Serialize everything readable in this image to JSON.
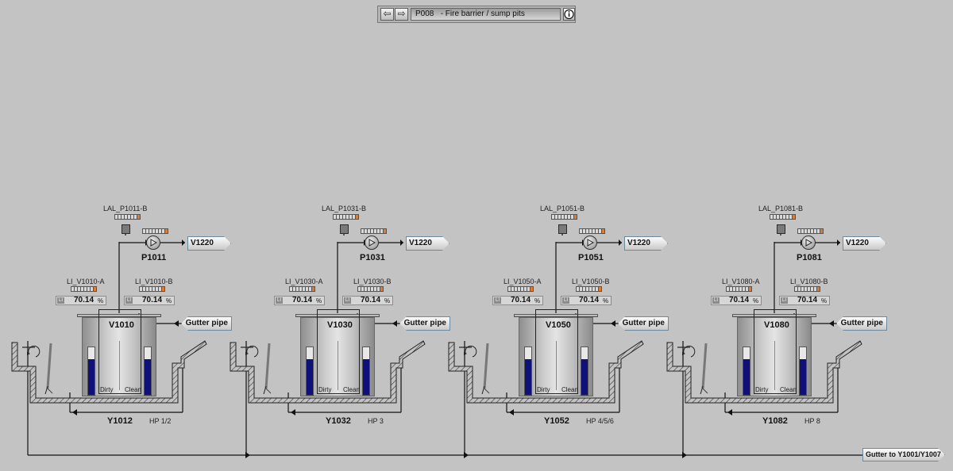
{
  "nav": {
    "back_icon": "arrow-left-icon",
    "forward_icon": "arrow-right-icon",
    "title": "P008   - Fire barrier / sump pits",
    "info_icon": "info-icon"
  },
  "common": {
    "pct_unit": "%",
    "dirty_label": "Dirty",
    "clean_label": "Clean",
    "li_tag": "LI",
    "colors": {
      "led_on": "#e57a2e",
      "level_fill": "#10107a",
      "background": "#c3c3c3"
    }
  },
  "stations": [
    {
      "lal": "LAL_P1011-B",
      "pump": "P1011",
      "dest": "V1220",
      "li_a": "LI_V1010-A",
      "li_a_value": "70.14",
      "li_b": "LI_V1010-B",
      "li_b_value": "70.14",
      "tank": "V1010",
      "gutter": "Gutter pipe",
      "pit": "Y1012",
      "hp": "HP 1/2",
      "level_fraction": 0.75
    },
    {
      "lal": "LAL_P1031-B",
      "pump": "P1031",
      "dest": "V1220",
      "li_a": "LI_V1030-A",
      "li_a_value": "70.14",
      "li_b": "LI_V1030-B",
      "li_b_value": "70.14",
      "tank": "V1030",
      "gutter": "Gutter pipe",
      "pit": "Y1032",
      "hp": "HP 3",
      "level_fraction": 0.75
    },
    {
      "lal": "LAL_P1051-B",
      "pump": "P1051",
      "dest": "V1220",
      "li_a": "LI_V1050-A",
      "li_a_value": "70.14",
      "li_b": "LI_V1050-B",
      "li_b_value": "70.14",
      "tank": "V1050",
      "gutter": "Gutter pipe",
      "pit": "Y1052",
      "hp": "HP 4/5/6",
      "level_fraction": 0.75
    },
    {
      "lal": "LAL_P1081-B",
      "pump": "P1081",
      "dest": "V1220",
      "li_a": "LI_V1080-A",
      "li_a_value": "70.14",
      "li_b": "LI_V1080-B",
      "li_b_value": "70.14",
      "tank": "V1080",
      "gutter": "Gutter pipe",
      "pit": "Y1082",
      "hp": "HP 8",
      "level_fraction": 0.75
    }
  ],
  "outlet": {
    "label": "Gutter to Y1001/Y1007"
  }
}
